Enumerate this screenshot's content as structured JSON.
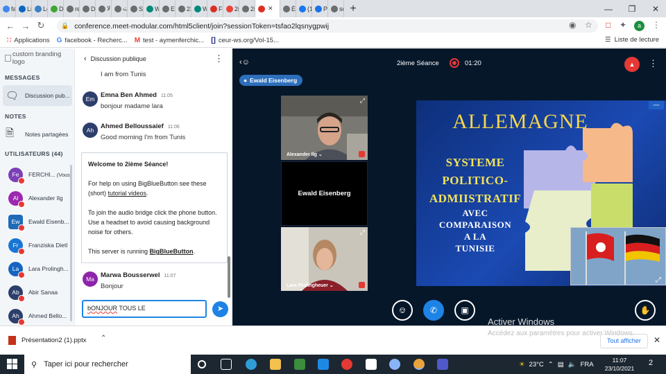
{
  "browser": {
    "tabs": [
      {
        "label": "fa",
        "color": "#4285f4"
      },
      {
        "label": "Li",
        "color": "#0a66c2"
      },
      {
        "label": "Le",
        "color": "#3b82c4"
      },
      {
        "label": "Di",
        "color": "#3fa535"
      },
      {
        "label": "re",
        "color": "#6d6d6d"
      },
      {
        "label": "Di",
        "color": "#6d6d6d"
      },
      {
        "label": "الا",
        "color": "#6d6d6d"
      },
      {
        "label": "الت",
        "color": "#6d6d6d"
      },
      {
        "label": "Sc",
        "color": "#6d6d6d"
      },
      {
        "label": "W",
        "color": "#00897b"
      },
      {
        "label": "E",
        "color": "#6d6d6d"
      },
      {
        "label": "23",
        "color": "#6d6d6d"
      },
      {
        "label": "W",
        "color": "#00897b"
      },
      {
        "label": "Fe",
        "color": "#d93025"
      },
      {
        "label": "2ii",
        "color": "#ea4335"
      },
      {
        "label": "2ii",
        "color": "#6d6d6d"
      },
      {
        "label": "",
        "color": "#d93025"
      },
      {
        "label": "Év",
        "color": "#6d6d6d"
      },
      {
        "label": "(1",
        "color": "#1877f2"
      },
      {
        "label": "Pa",
        "color": "#1a73e8"
      },
      {
        "label": "sc",
        "color": "#6d6d6d"
      }
    ],
    "url": "conference.meet-modular.com/html5client/join?sessionToken=tsfao2lqsnygpwij",
    "profile_initial": "a",
    "bookmarks": [
      {
        "icon": "apps-icon",
        "label": "Applications"
      },
      {
        "icon": "G",
        "label": "facebook - Recherc..."
      },
      {
        "icon": "M",
        "label": "test - aymenferchic..."
      },
      {
        "icon": "[]",
        "label": "ceur-ws.org/Vol-15..."
      }
    ],
    "reading_list": "Liste de lecture"
  },
  "sidebar": {
    "branding_alt": "custom branding logo",
    "messages_heading": "MESSAGES",
    "public_chat": "Discussion pub...",
    "notes_heading": "NOTES",
    "shared_notes": "Notes partagées",
    "users_heading": "UTILISATEURS (44)",
    "users": [
      {
        "initials": "Fe",
        "name": "FERCHI...",
        "suffix": "(Vous)",
        "color": "#7b3fb6",
        "square": false
      },
      {
        "initials": "Al",
        "name": "Alexander Ilg",
        "suffix": "",
        "color": "#9c27b0",
        "square": false
      },
      {
        "initials": "Ew",
        "name": "Ewald Eisenb...",
        "suffix": "",
        "color": "#1e6bb8",
        "square": true
      },
      {
        "initials": "Fr",
        "name": "Franziska Dietl",
        "suffix": "",
        "color": "#1976d2",
        "square": false
      },
      {
        "initials": "La",
        "name": "Lara Prolingh...",
        "suffix": "",
        "color": "#1565c0",
        "square": false
      },
      {
        "initials": "Ab",
        "name": "Abir Sanaa",
        "suffix": "",
        "color": "#2c3e6b",
        "square": false
      },
      {
        "initials": "Ah",
        "name": "Ahmed Bello...",
        "suffix": "",
        "color": "#2c3e6b",
        "square": false
      }
    ]
  },
  "chat": {
    "title": "Discussion publique",
    "messages": [
      {
        "initials": "",
        "name": "",
        "time": "",
        "text": "I am from Tunis",
        "color": "#7b3fb6"
      },
      {
        "initials": "Em",
        "name": "Emna Ben Ahmed",
        "time": "11:05",
        "text": "bonjour madame lara",
        "color": "#2c3e6b"
      },
      {
        "initials": "Ah",
        "name": "Ahmed Belloussaief",
        "time": "11:06",
        "text": "Good morning I'm from Tunis",
        "color": "#2c3e6b"
      },
      {
        "initials": "Ma",
        "name": "Marwa Bousserwel",
        "time": "11:07",
        "text": "Bonjour",
        "color": "#8e24aa"
      }
    ],
    "welcome": {
      "title": "Welcome to 2ième Séance!",
      "help_pre": "For help on using BigBlueButton see these (short) ",
      "help_link": "tutorial videos",
      "help_post": ".",
      "audio": "To join the audio bridge click the phone button. Use a headset to avoid causing background noise for others.",
      "server_pre": "This server is running ",
      "server_link": "BigBlueButton",
      "server_post": "."
    },
    "input_value_first": "bONJOUR",
    "input_value_rest": " TOUS LE"
  },
  "meeting": {
    "name": "2ième Séance",
    "timer": "01:20",
    "talking": "Ewald Eisenberg",
    "videos": [
      {
        "label": "Alexander Ilg"
      },
      {
        "label": "Ewald Eisenberg"
      },
      {
        "label": "Lara Prolingheuer"
      }
    ],
    "slide": {
      "title": "ALLEMAGNE",
      "lines": [
        "SYSTEME",
        "POLITICO-",
        "ADMIISTRATIF"
      ],
      "lines_white": [
        "AVEC",
        "COMPARAISON",
        "A  LA",
        "TUNISIE"
      ]
    },
    "windows_watermark_1": "Activer Windows",
    "windows_watermark_2": "Accédez aux paramètres pour activer Windows."
  },
  "downloads": {
    "file": "Présentation2 (1).pptx",
    "show_all": "Tout afficher"
  },
  "taskbar": {
    "search_placeholder": "Taper ici pour rechercher",
    "temperature": "23°C",
    "language": "FRA",
    "time": "11:07",
    "date": "23/10/2021",
    "notif_count": "2"
  }
}
